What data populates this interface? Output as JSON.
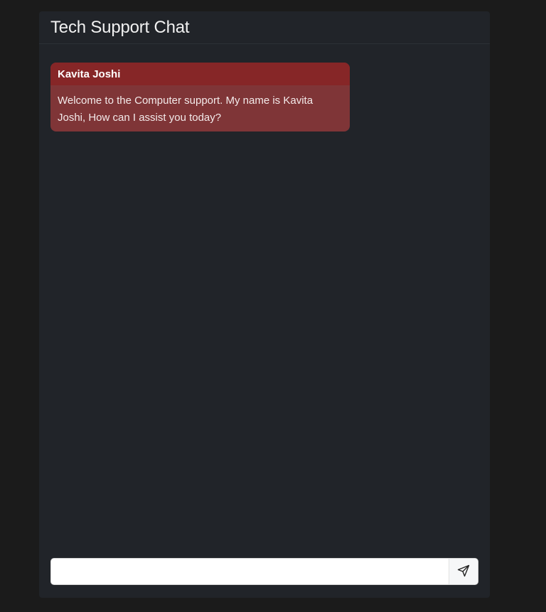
{
  "header": {
    "title": "Tech Support Chat"
  },
  "messages": [
    {
      "sender": "Kavita Joshi",
      "text": "Welcome to the Computer support. My name is Kavita Joshi, How can I assist you today?"
    }
  ],
  "composer": {
    "input_value": "",
    "send_icon": "send-icon"
  },
  "colors": {
    "page_background": "#1b1b1b",
    "panel_background": "#212429",
    "message_header": "#862627",
    "message_body": "#7f3537"
  }
}
